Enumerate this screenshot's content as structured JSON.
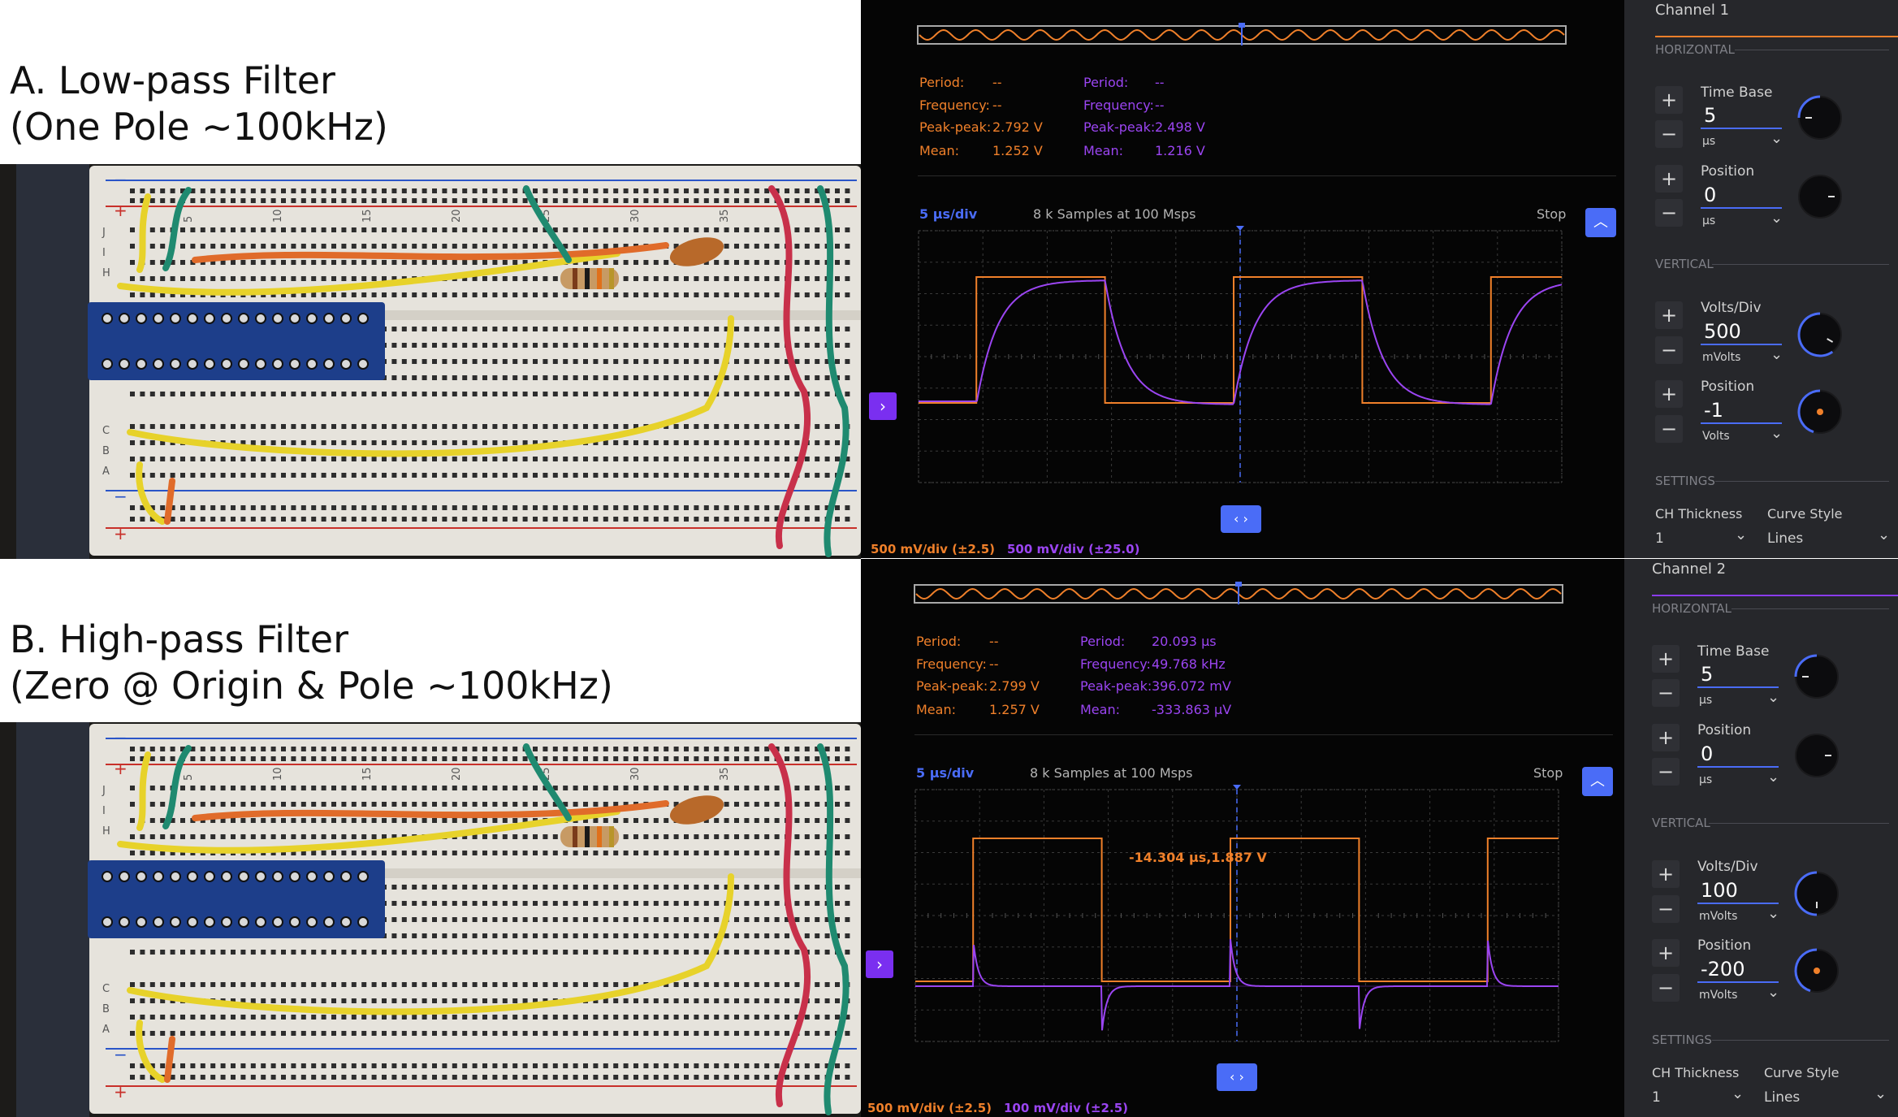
{
  "headings": {
    "a_line1": "A.  Low-pass Filter",
    "a_line2": "(One Pole ~100kHz)",
    "b_line1": "B. High-pass Filter",
    "b_line2": "(Zero @ Origin & Pole ~100kHz)"
  },
  "breadboard": {
    "rail_plus": "+",
    "rail_minus": "−",
    "row_labels": [
      "J",
      "I",
      "H",
      "C",
      "B",
      "A"
    ],
    "column_numbers": [
      "5",
      "10",
      "15",
      "20",
      "25",
      "30",
      "35"
    ]
  },
  "scopes": [
    {
      "id": "A",
      "measurements": {
        "ch1": {
          "period_label": "Period:",
          "period_value": "--",
          "frequency_label": "Frequency:",
          "frequency_value": "--",
          "peak_label": "Peak-peak:",
          "peak_value": "2.792 V",
          "mean_label": "Mean:",
          "mean_value": "1.252 V"
        },
        "ch2": {
          "period_label": "Period:",
          "period_value": "--",
          "frequency_label": "Frequency:",
          "frequency_value": "--",
          "peak_label": "Peak-peak:",
          "peak_value": "2.498 V",
          "mean_label": "Mean:",
          "mean_value": "1.216 V"
        }
      },
      "header": {
        "timebase": "5 μs/div",
        "samples": "8 k Samples at 100 Msps",
        "status": "Stop"
      },
      "cursor_readout": "",
      "footer": {
        "ch1_scale": "500 mV/div (±2.5)",
        "ch2_scale": "500 mV/div (±25.0)"
      },
      "icons": {
        "expand": "chevron-up-icon",
        "channel_marker": "chevron-right-icon",
        "trigger": "left-right-arrows-icon"
      }
    },
    {
      "id": "B",
      "measurements": {
        "ch1": {
          "period_label": "Period:",
          "period_value": "--",
          "frequency_label": "Frequency:",
          "frequency_value": "--",
          "peak_label": "Peak-peak:",
          "peak_value": "2.799 V",
          "mean_label": "Mean:",
          "mean_value": "1.257 V"
        },
        "ch2": {
          "period_label": "Period:",
          "period_value": "20.093 μs",
          "frequency_label": "Frequency:",
          "frequency_value": "49.768 kHz",
          "peak_label": "Peak-peak:",
          "peak_value": "396.072 mV",
          "mean_label": "Mean:",
          "mean_value": "-333.863 μV"
        }
      },
      "header": {
        "timebase": "5 μs/div",
        "samples": "8 k Samples at 100 Msps",
        "status": "Stop"
      },
      "cursor_readout": "-14.304 μs,1.887 V",
      "footer": {
        "ch1_scale": "500 mV/div (±2.5)",
        "ch2_scale": "100 mV/div (±2.5)"
      },
      "icons": {
        "expand": "chevron-up-icon",
        "channel_marker": "chevron-right-icon",
        "trigger": "left-right-arrows-icon"
      }
    }
  ],
  "panels": [
    {
      "title": "Channel 1",
      "accent": "#f0802a",
      "horizontal_label": "HORIZONTAL",
      "timebase_label": "Time Base",
      "timebase_value": "5",
      "timebase_unit": "μs",
      "hpos_label": "Position",
      "hpos_value": "0",
      "hpos_unit": "μs",
      "vertical_label": "VERTICAL",
      "vdiv_label": "Volts/Div",
      "vdiv_value": "500",
      "vdiv_unit": "mVolts",
      "vpos_label": "Position",
      "vpos_value": "-1",
      "vpos_unit": "Volts",
      "settings_label": "SETTINGS",
      "thickness_label": "CH Thickness",
      "thickness_value": "1",
      "curve_label": "Curve Style",
      "curve_value": "Lines",
      "plus": "+",
      "minus": "−"
    },
    {
      "title": "Channel 2",
      "accent": "#8a3cf0",
      "horizontal_label": "HORIZONTAL",
      "timebase_label": "Time Base",
      "timebase_value": "5",
      "timebase_unit": "μs",
      "hpos_label": "Position",
      "hpos_value": "0",
      "hpos_unit": "μs",
      "vertical_label": "VERTICAL",
      "vdiv_label": "Volts/Div",
      "vdiv_value": "100",
      "vdiv_unit": "mVolts",
      "vpos_label": "Position",
      "vpos_value": "-200",
      "vpos_unit": "mVolts",
      "settings_label": "SETTINGS",
      "thickness_label": "CH Thickness",
      "thickness_value": "1",
      "curve_label": "Curve Style",
      "curve_value": "Lines",
      "plus": "+",
      "minus": "−"
    }
  ],
  "colors": {
    "ch1": "#f0802a",
    "ch2": "#9b45f2",
    "accent": "#4a6cf7"
  }
}
